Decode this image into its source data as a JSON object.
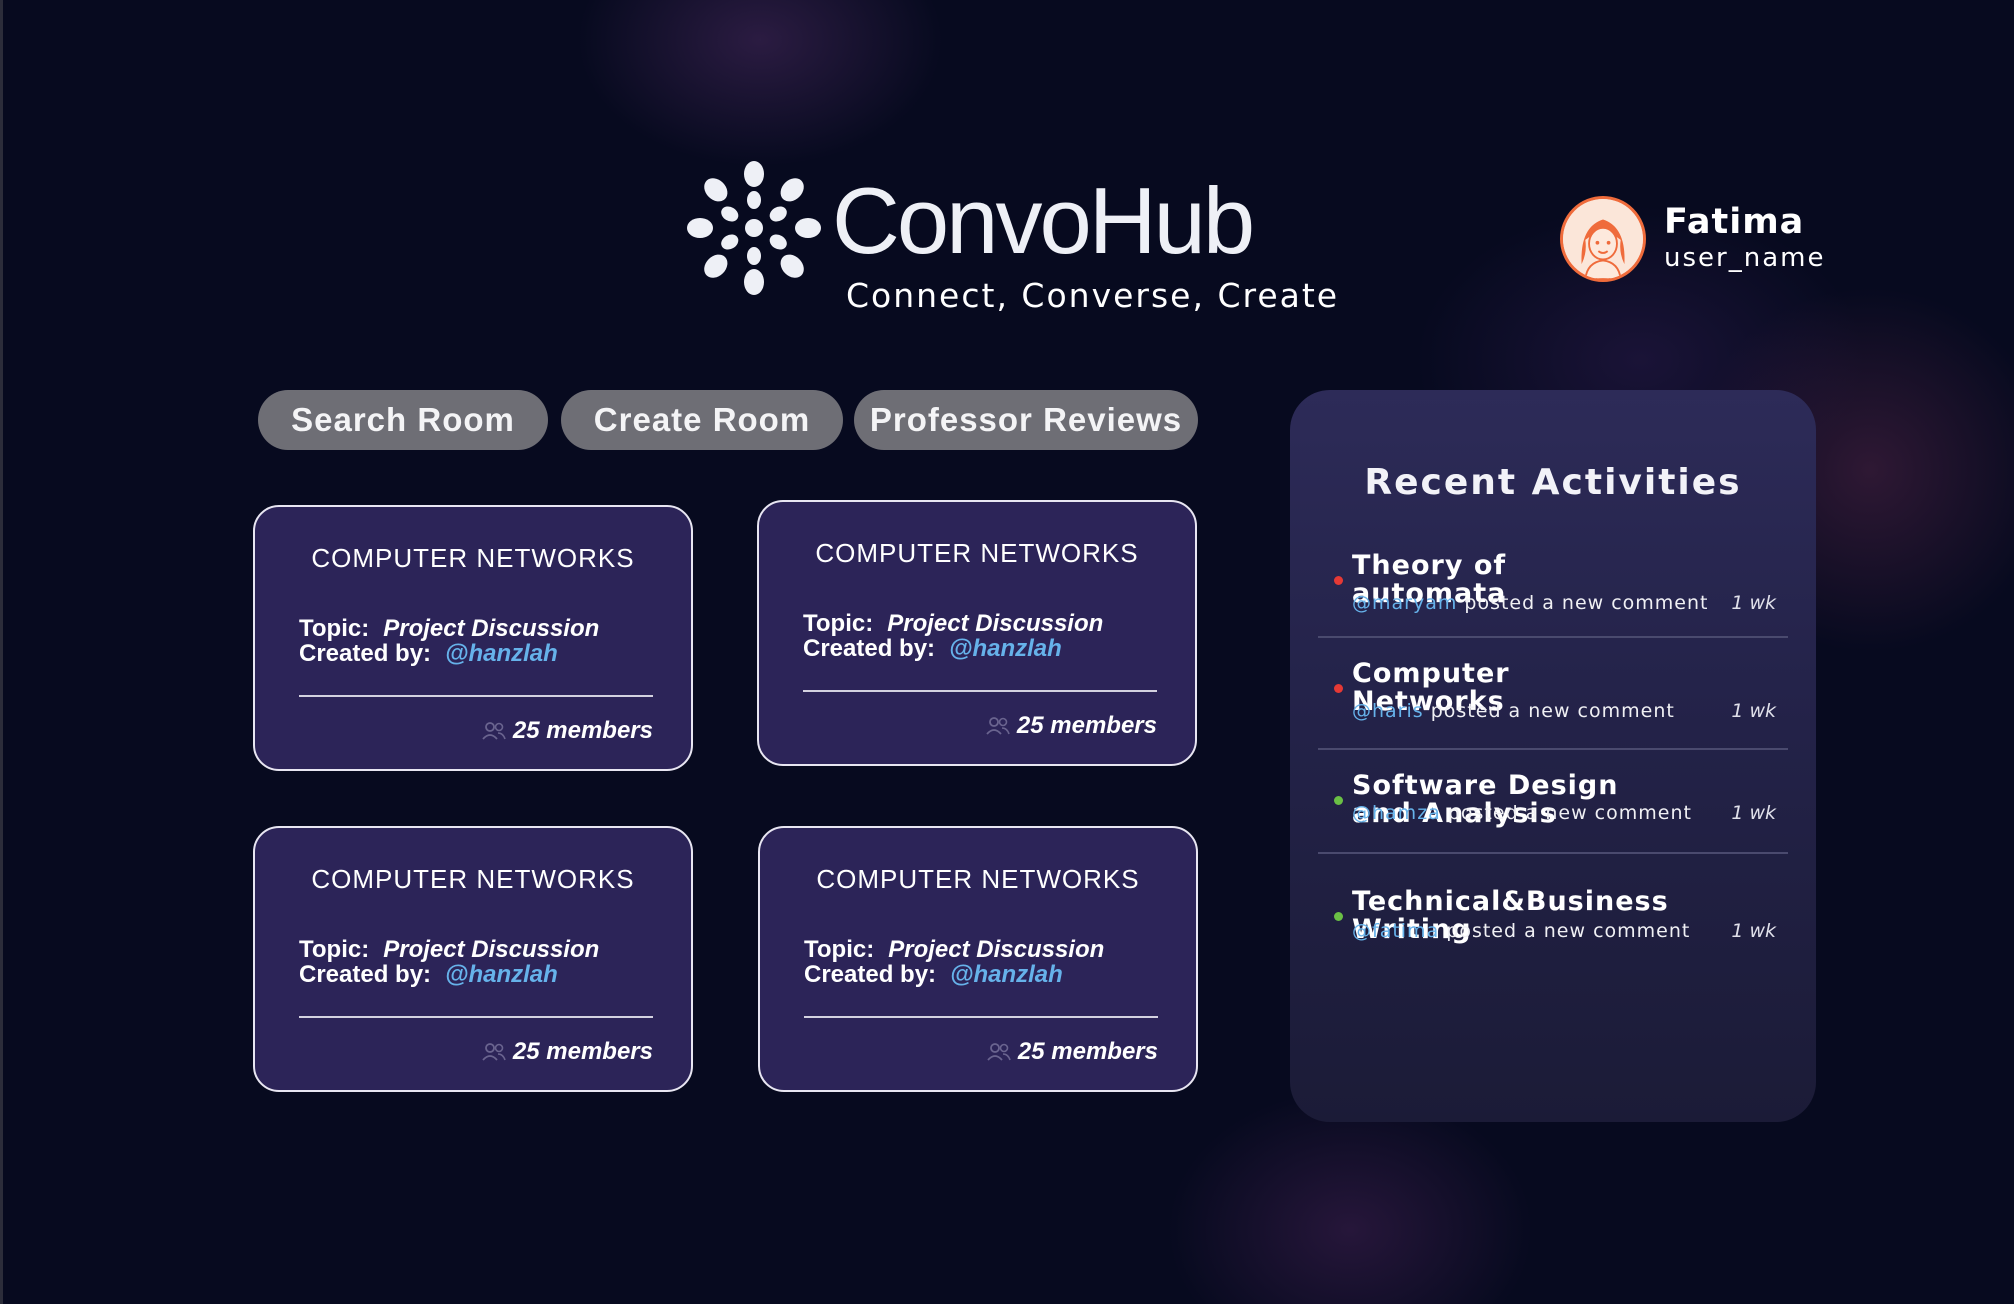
{
  "brand": {
    "name": "ConvoHub",
    "tagline": "Connect, Converse, Create"
  },
  "user": {
    "name": "Fatima",
    "handle": "user_name"
  },
  "nav": [
    {
      "label": "Search Room"
    },
    {
      "label": "Create Room"
    },
    {
      "label": "Professor Reviews"
    }
  ],
  "rooms": [
    {
      "title": "COMPUTER NETWORKS",
      "topic_label": "Topic:",
      "topic": "Project Discussion",
      "creator_label": "Created by:",
      "creator": "@hanzlah",
      "members": "25 members",
      "members_icon": "users-icon"
    },
    {
      "title": "COMPUTER NETWORKS",
      "topic_label": "Topic:",
      "topic": "Project Discussion",
      "creator_label": "Created by:",
      "creator": "@hanzlah",
      "members": "25 members",
      "members_icon": "users-icon"
    },
    {
      "title": "COMPUTER NETWORKS",
      "topic_label": "Topic:",
      "topic": "Project Discussion",
      "creator_label": "Created by:",
      "creator": "@hanzlah",
      "members": "25 members",
      "members_icon": "users-icon"
    },
    {
      "title": "COMPUTER NETWORKS",
      "topic_label": "Topic:",
      "topic": "Project Discussion",
      "creator_label": "Created by:",
      "creator": "@hanzlah",
      "members": "25 members",
      "members_icon": "users-icon"
    }
  ],
  "activities": {
    "title": "Recent Activities",
    "items": [
      {
        "title": "Theory of automata",
        "user": "@maryam",
        "action": " posted a new comment",
        "time": "1 wk",
        "status_color": "#e53935"
      },
      {
        "title": "Computer Networks",
        "user": "@haris",
        "action": " posted a new comment",
        "time": "1 wk",
        "status_color": "#e53935"
      },
      {
        "title": "Software Design and Analysis",
        "user": "@hamza",
        "action": " posted a new comment",
        "time": "1 wk",
        "status_color": "#6abf45"
      },
      {
        "title": "Technical&Business Writing",
        "user": "@fatima",
        "action": " posted a new comment",
        "time": "1 wk",
        "status_color": "#6abf45"
      }
    ]
  },
  "colors": {
    "background": "#070a1f",
    "card": "#2c2458",
    "button": "#6e6e75",
    "link": "#66b2ea",
    "avatar_ring": "#ef6b3b"
  }
}
